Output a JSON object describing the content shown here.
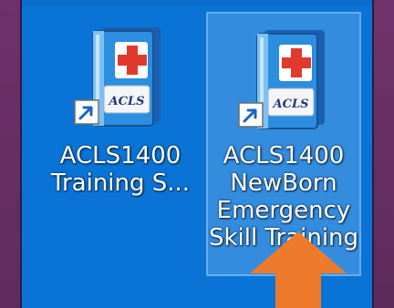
{
  "desktop": {
    "icons": [
      {
        "label_lines": [
          "ACLS1400",
          "Training S..."
        ],
        "badge_text": "ACLS",
        "icon": "medical-binder-icon",
        "shortcut_icon": "shortcut-arrow-icon",
        "selected": false
      },
      {
        "label_lines": [
          "ACLS1400",
          "NewBorn",
          "Emergency",
          "Skill Training"
        ],
        "badge_text": "ACLS",
        "icon": "medical-binder-icon",
        "shortcut_icon": "shortcut-arrow-icon",
        "selected": true
      }
    ],
    "pointer": {
      "icon": "orange-up-arrow-icon",
      "color": "#ee7b2c"
    }
  },
  "colors": {
    "desktop_background": "#0a74d6",
    "frame": "#62295e",
    "selection": "#78b4f0",
    "binder_blue": "#2b8ee0",
    "cross_red": "#e1392d"
  }
}
